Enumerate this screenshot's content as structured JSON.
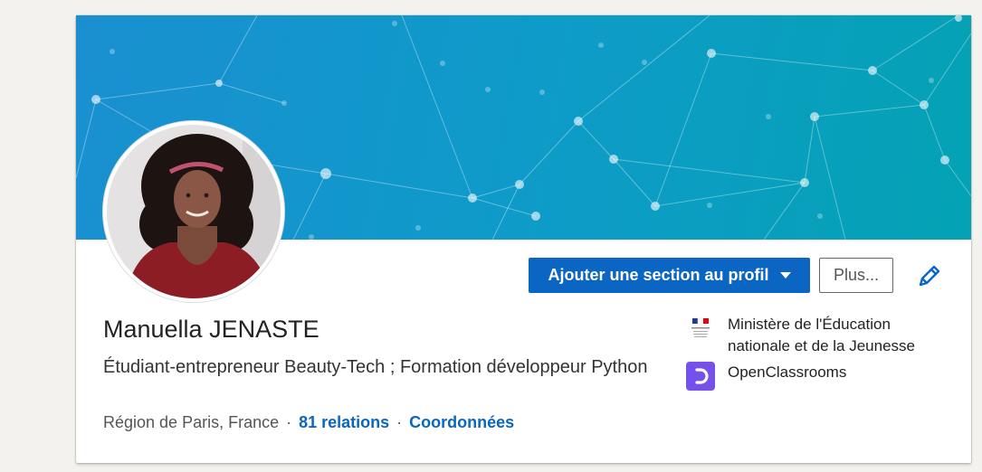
{
  "profile": {
    "name": "Manuella JENASTE",
    "headline": "Étudiant-entrepreneur Beauty-Tech ; Formation développeur Python",
    "location": "Région de Paris, France",
    "connections": "81 relations",
    "contact_link": "Coordonnées"
  },
  "actions": {
    "add_section_label": "Ajouter une section au profil",
    "more_label": "Plus..."
  },
  "organizations": [
    {
      "name": "Ministère de l'Éducation nationale et de la Jeunesse",
      "icon": "gov-emblem-icon"
    },
    {
      "name": "OpenClassrooms",
      "icon": "openclassrooms-logo-icon"
    }
  ],
  "colors": {
    "brand_blue": "#0a66c2",
    "banner_start": "#1a8fd0",
    "banner_end": "#04a2b4",
    "openclassrooms_purple": "#7451eb"
  }
}
